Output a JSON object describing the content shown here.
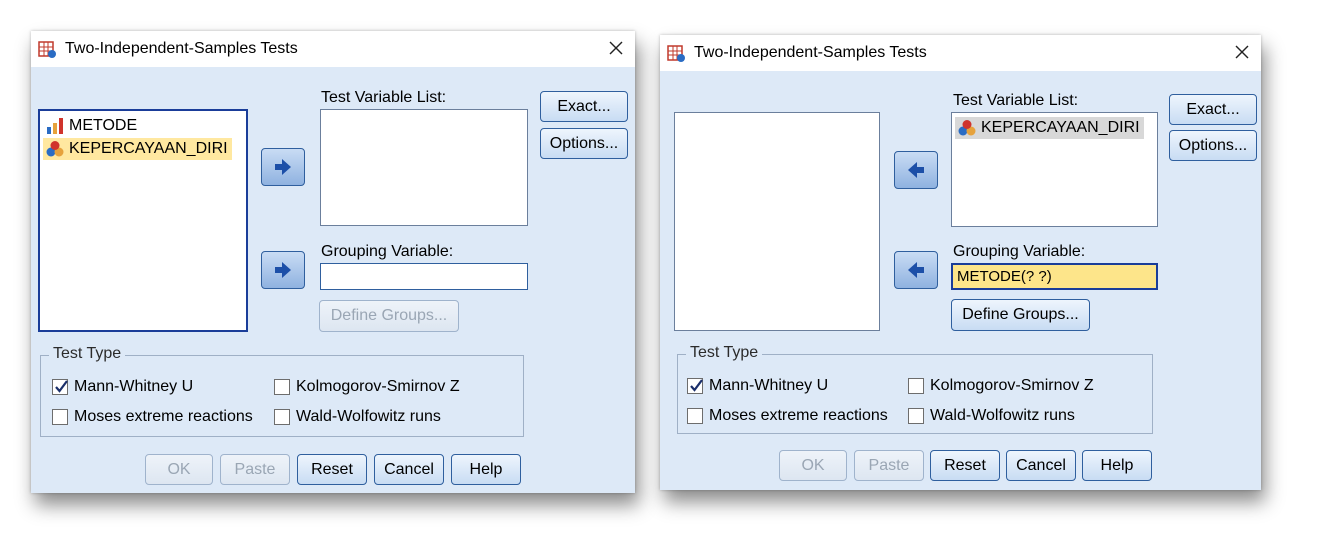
{
  "dialogs": [
    {
      "title": "Two-Independent-Samples Tests",
      "source_list": [
        {
          "label": "METODE",
          "icon": "nominal-variable-icon",
          "selected": false
        },
        {
          "label": "KEPERCAYAAN_DIRI",
          "icon": "scale-variable-icon",
          "selected": true
        }
      ],
      "test_variable_list": {
        "label": "Test Variable List:",
        "items": []
      },
      "grouping_variable": {
        "label": "Grouping Variable:",
        "value": ""
      },
      "define_groups": "Define Groups...",
      "exact": "Exact...",
      "options": "Options...",
      "test_type": {
        "label": "Test Type",
        "mann_whitney": {
          "label": "Mann-Whitney U",
          "checked": true
        },
        "kolmogorov": {
          "label": "Kolmogorov-Smirnov Z",
          "checked": false
        },
        "moses": {
          "label": "Moses extreme reactions",
          "checked": false
        },
        "wald": {
          "label": "Wald-Wolfowitz runs",
          "checked": false
        }
      },
      "buttons": {
        "ok": "OK",
        "paste": "Paste",
        "reset": "Reset",
        "cancel": "Cancel",
        "help": "Help"
      }
    },
    {
      "title": "Two-Independent-Samples Tests",
      "source_list": [],
      "test_variable_list": {
        "label": "Test Variable List:",
        "items": [
          {
            "label": "KEPERCAYAAN_DIRI",
            "icon": "scale-variable-icon"
          }
        ]
      },
      "grouping_variable": {
        "label": "Grouping Variable:",
        "value": "METODE(? ?)"
      },
      "define_groups": "Define Groups...",
      "exact": "Exact...",
      "options": "Options...",
      "test_type": {
        "label": "Test Type",
        "mann_whitney": {
          "label": "Mann-Whitney U",
          "checked": true
        },
        "kolmogorov": {
          "label": "Kolmogorov-Smirnov Z",
          "checked": false
        },
        "moses": {
          "label": "Moses extreme reactions",
          "checked": false
        },
        "wald": {
          "label": "Wald-Wolfowitz runs",
          "checked": false
        }
      },
      "buttons": {
        "ok": "OK",
        "paste": "Paste",
        "reset": "Reset",
        "cancel": "Cancel",
        "help": "Help"
      }
    }
  ],
  "colors": {
    "dialog_bg": "#dde9f7",
    "selection": "#ffe8a0",
    "grouping_highlight": "#fde58a",
    "button_border": "#2f5f9e"
  }
}
